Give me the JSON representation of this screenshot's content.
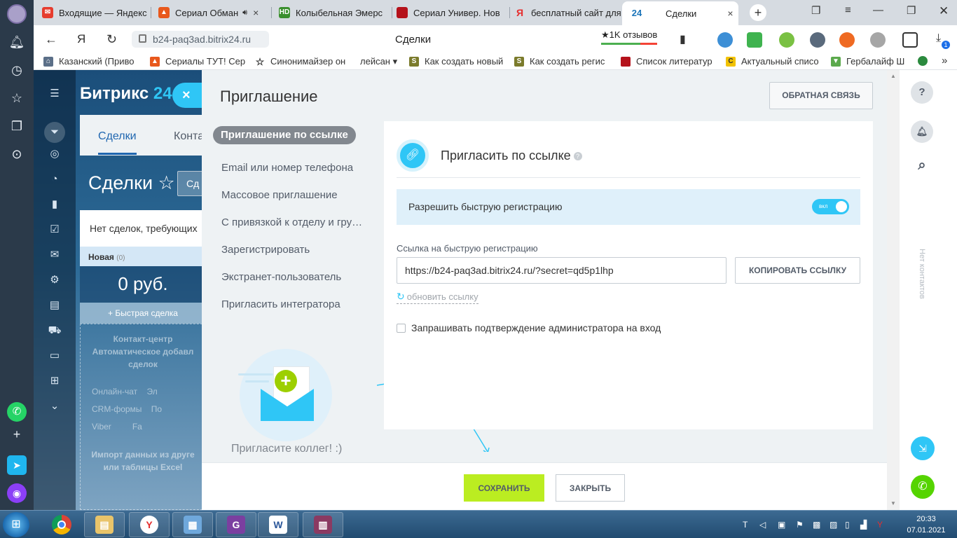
{
  "browser": {
    "tabs": [
      {
        "label": "Входящие — Яндекс",
        "icon": "mail-icon",
        "color": "#e63c2e"
      },
      {
        "label": "Сериал Обман",
        "icon": "fox-icon",
        "color": "#e8581c"
      },
      {
        "label": "Колыбельная Эмерс",
        "icon": "hd-icon",
        "color": "#3a8f2e"
      },
      {
        "label": "Сериал Универ. Нов",
        "icon": "book-icon",
        "color": "#b5121b"
      },
      {
        "label": "бесплатный сайт для",
        "icon": "yandex-icon",
        "color": "#e62e2e"
      },
      {
        "label": "Сделки",
        "icon": "bitrix-icon",
        "color": "#2fc6f6"
      }
    ],
    "active_tab_favicon_text": "24",
    "back_glyph": "←",
    "yandex_glyph": "Я",
    "reload_glyph": "↻",
    "url": "b24-paq3ad.bitrix24.ru",
    "page_title": "Сделки",
    "reviews": "★1K отзывов",
    "bookmarks": [
      {
        "label": "Казанский (Приво",
        "icon": "bank-icon"
      },
      {
        "label": "Сериалы ТУТ! Сер",
        "icon": "fox-icon"
      },
      {
        "label": "Синонимайзер он",
        "icon": "star-icon"
      },
      {
        "label": "лейсан ▾",
        "icon": "folder-icon"
      },
      {
        "label": "Как создать новый",
        "icon": "s-icon"
      },
      {
        "label": "Как создать регис",
        "icon": "s-icon"
      },
      {
        "label": "Список литератур",
        "icon": "book-icon"
      },
      {
        "label": "Актуальный списо",
        "icon": "c-icon"
      },
      {
        "label": "Гербалайф Ш",
        "icon": "leaf-icon"
      }
    ],
    "more": "»",
    "download_badge": "1"
  },
  "bitrix_bg": {
    "logo": "Битрикс",
    "logo_num": "24",
    "tab_deals": "Сделки",
    "tab_contacts": "Конта",
    "title": "Сделки ☆",
    "filter_stub": "Сд",
    "warning": "Нет сделок, требующих",
    "column_title": "Новая",
    "column_count": "(0)",
    "sum": "0 руб.",
    "quick_deal": "+ Быстрая сделка",
    "cc_title": "Контакт-центр",
    "cc_line1": "Автоматическое добавл",
    "cc_line2": "сделок",
    "cc_items": [
      "Онлайн-чат",
      "CRM-формы",
      "Viber"
    ],
    "cc_items_right": [
      "Эл",
      "По",
      "Fa"
    ],
    "import1": "Импорт данных из друге",
    "import2": "или таблицы Excel"
  },
  "right_panel": {
    "help": "?",
    "bell": "🔔",
    "search": "⌕",
    "vertical": "Нет контактов"
  },
  "slider": {
    "title": "Приглашение",
    "close_glyph": "×",
    "feedback": "ОБРАТНАЯ СВЯЗЬ",
    "menu": [
      "Приглашение по ссылке",
      "Email или номер телефона",
      "Массовое приглашение",
      "С привязкой к отделу и группе",
      "Зарегистрировать",
      "Экстранет-пользователь",
      "Пригласить интегратора"
    ],
    "illustration_caption": "Пригласите коллег! :)",
    "card": {
      "title": "Пригласить по ссылке",
      "help": "?",
      "fast_reg_label": "Разрешить быструю регистрацию",
      "toggle_label": "вкл",
      "toggle_on": true,
      "link_label": "Ссылка на быструю регистрацию",
      "link_value": "https://b24-paq3ad.bitrix24.ru/?secret=qd5p1lhp",
      "copy_btn": "КОПИРОВАТЬ ССЫЛКУ",
      "refresh": "обновить ссылку",
      "confirm_label": "Запрашивать подтверждение администратора на вход",
      "confirm_checked": false
    },
    "save": "СОХРАНИТЬ",
    "close": "ЗАКРЫТЬ"
  },
  "taskbar": {
    "time": "20:33",
    "date": "07.01.2021"
  }
}
